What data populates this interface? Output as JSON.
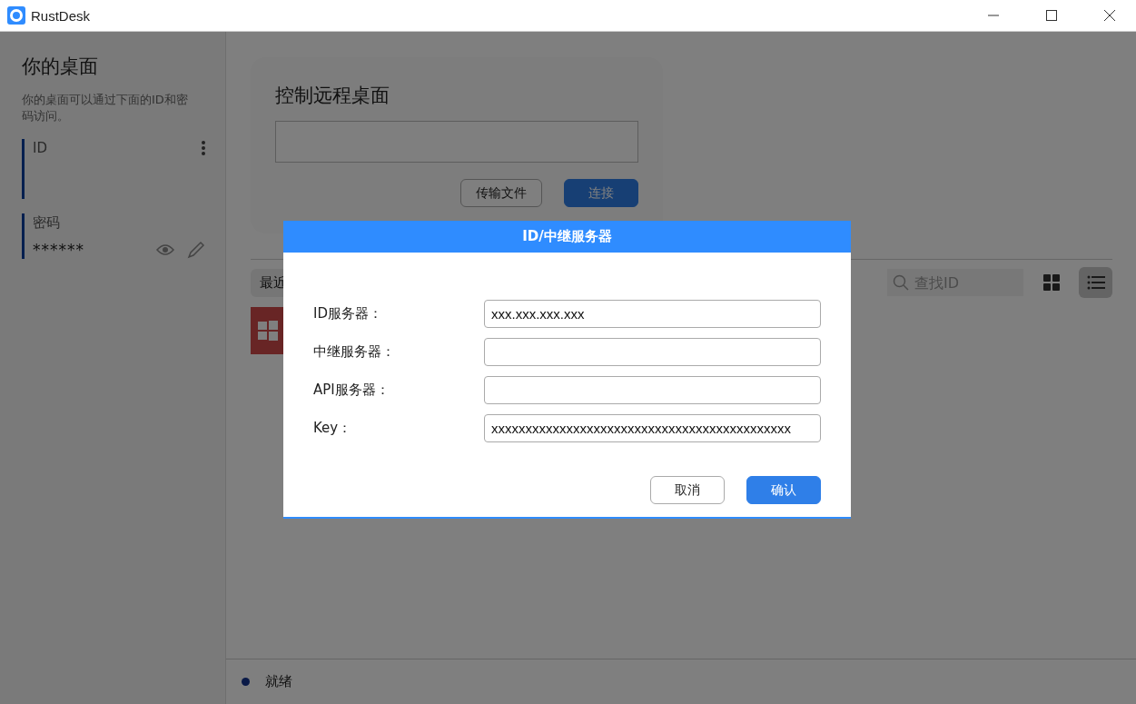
{
  "window": {
    "title": "RustDesk"
  },
  "sidebar": {
    "title": "你的桌面",
    "description": "你的桌面可以通过下面的ID和密码访问。",
    "id_label": "ID",
    "password_label": "密码",
    "password_value": "******"
  },
  "remote_card": {
    "title": "控制远程桌面",
    "buttons": [
      {
        "label": "传输文件",
        "kind": "secondary"
      },
      {
        "label": "连接",
        "kind": "primary"
      }
    ]
  },
  "recent": {
    "tab_label": "最近",
    "search": {
      "placeholder": "查找ID"
    },
    "view_buttons": [
      {
        "kind": "grid",
        "selected": false
      },
      {
        "kind": "list",
        "selected": true
      }
    ]
  },
  "dialog": {
    "title": "ID/中继服务器",
    "fields": [
      {
        "label": "ID服务器：",
        "value": "xxx.xxx.xxx.xxx"
      },
      {
        "label": "中继服务器："
      },
      {
        "label": "API服务器："
      },
      {
        "label": "Key：",
        "value": "xxxxxxxxxxxxxxxxxxxxxxxxxxxxxxxxxxxxxxxxxxxx"
      }
    ],
    "buttons": [
      {
        "label": "取消",
        "kind": "secondary"
      },
      {
        "label": "确认",
        "kind": "primary"
      }
    ]
  },
  "status_bar": {
    "text": "就绪"
  }
}
